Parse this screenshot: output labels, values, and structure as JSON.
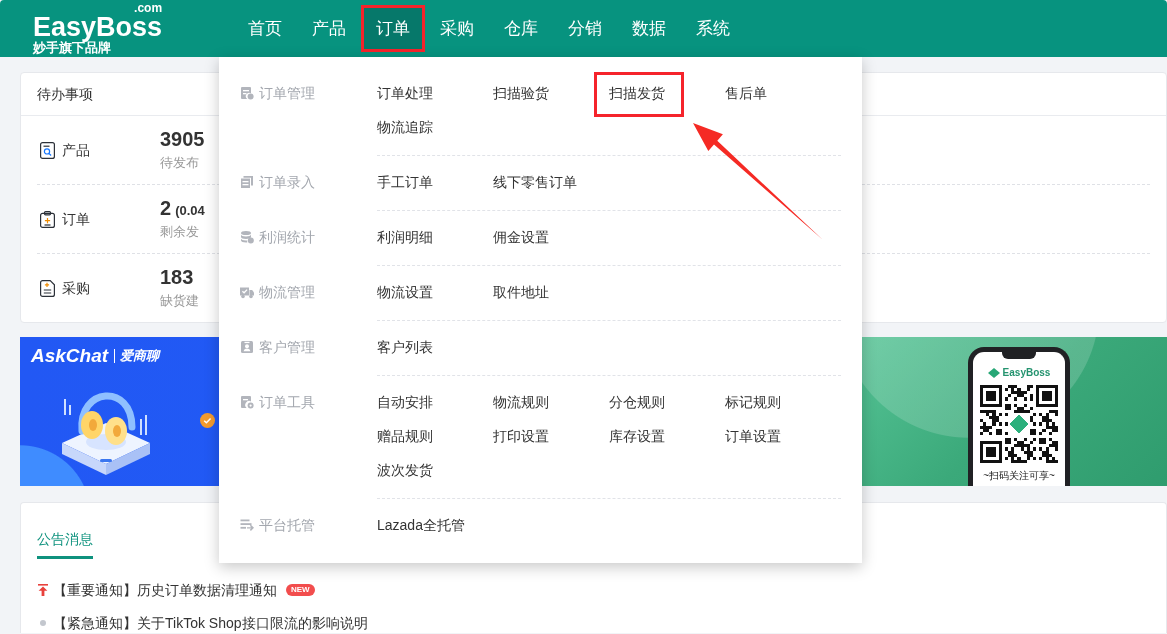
{
  "header": {
    "logo": "EasyBoss",
    "logo_suffix": ".com",
    "tagline": "妙手旗下品牌",
    "nav": [
      {
        "label": "首页",
        "selected": false,
        "marked": false
      },
      {
        "label": "产品",
        "selected": false,
        "marked": false
      },
      {
        "label": "订单",
        "selected": true,
        "marked": true
      },
      {
        "label": "采购",
        "selected": false,
        "marked": false
      },
      {
        "label": "仓库",
        "selected": false,
        "marked": false
      },
      {
        "label": "分销",
        "selected": false,
        "marked": false
      },
      {
        "label": "数据",
        "selected": false,
        "marked": false
      },
      {
        "label": "系统",
        "selected": false,
        "marked": false
      }
    ]
  },
  "todo_card": {
    "title": "待办事项",
    "rows": [
      {
        "label": "产品",
        "value": "3905",
        "note": "待发布"
      },
      {
        "label": "订单",
        "value": "2",
        "detail": "(0.04",
        "note": "剩余发"
      },
      {
        "label": "采购",
        "value": "183",
        "note": "缺货建"
      }
    ]
  },
  "banners": [
    {
      "kind": "askchat",
      "brand": "AskChat",
      "brand_cn": "爱商聊"
    },
    {
      "kind": "qr",
      "brand": "EasyBoss",
      "caption": "~扫码关注可享~"
    }
  ],
  "notice_card": {
    "tabs": [
      {
        "label": "公告消息",
        "selected": true
      }
    ],
    "items": [
      {
        "kind": "pinned",
        "text": "【重要通知】历史订单数据清理通知",
        "badge": "NEW"
      },
      {
        "kind": "normal",
        "text": "【紧急通知】关于TikTok Shop接口限流的影响说明"
      }
    ]
  },
  "order_menu": {
    "groups": [
      {
        "title": "订单管理",
        "links": [
          {
            "label": "订单处理",
            "marked": false
          },
          {
            "label": "扫描验货",
            "marked": false
          },
          {
            "label": "扫描发货",
            "marked": true
          },
          {
            "label": "售后单",
            "marked": false
          },
          {
            "label": "物流追踪",
            "marked": false
          }
        ]
      },
      {
        "title": "订单录入",
        "links": [
          {
            "label": "手工订单",
            "marked": false
          },
          {
            "label": "线下零售订单",
            "marked": false
          }
        ]
      },
      {
        "title": "利润统计",
        "links": [
          {
            "label": "利润明细",
            "marked": false
          },
          {
            "label": "佣金设置",
            "marked": false
          }
        ]
      },
      {
        "title": "物流管理",
        "links": [
          {
            "label": "物流设置",
            "marked": false
          },
          {
            "label": "取件地址",
            "marked": false
          }
        ]
      },
      {
        "title": "客户管理",
        "links": [
          {
            "label": "客户列表",
            "marked": false
          }
        ]
      },
      {
        "title": "订单工具",
        "links": [
          {
            "label": "自动安排",
            "marked": false
          },
          {
            "label": "物流规则",
            "marked": false
          },
          {
            "label": "分仓规则",
            "marked": false
          },
          {
            "label": "标记规则",
            "marked": false
          },
          {
            "label": "赠品规则",
            "marked": false
          },
          {
            "label": "打印设置",
            "marked": false
          },
          {
            "label": "库存设置",
            "marked": false
          },
          {
            "label": "订单设置",
            "marked": false
          },
          {
            "label": "波次发货",
            "marked": false
          }
        ]
      },
      {
        "title": "平台托管",
        "links": [
          {
            "label": "Lazada全托管",
            "marked": false
          }
        ]
      }
    ]
  }
}
